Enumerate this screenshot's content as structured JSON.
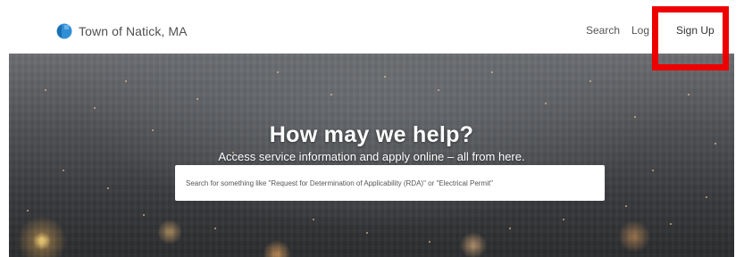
{
  "header": {
    "brand_name": "Town of Natick, MA",
    "logo_icon": "town-logo-icon",
    "nav": {
      "search_label": "Search",
      "login_label": "Log In",
      "signup_label": "Sign Up"
    }
  },
  "hero": {
    "title": "How may we help?",
    "subtitle": "Access service information and apply online – all from here.",
    "search": {
      "placeholder": "Search for something like \"Request for Determination of Applicability (RDA)\" or \"Electrical Permit\"",
      "value": ""
    }
  },
  "colors": {
    "logo_blue": "#2f8fd6",
    "highlight": "#ee0000"
  }
}
